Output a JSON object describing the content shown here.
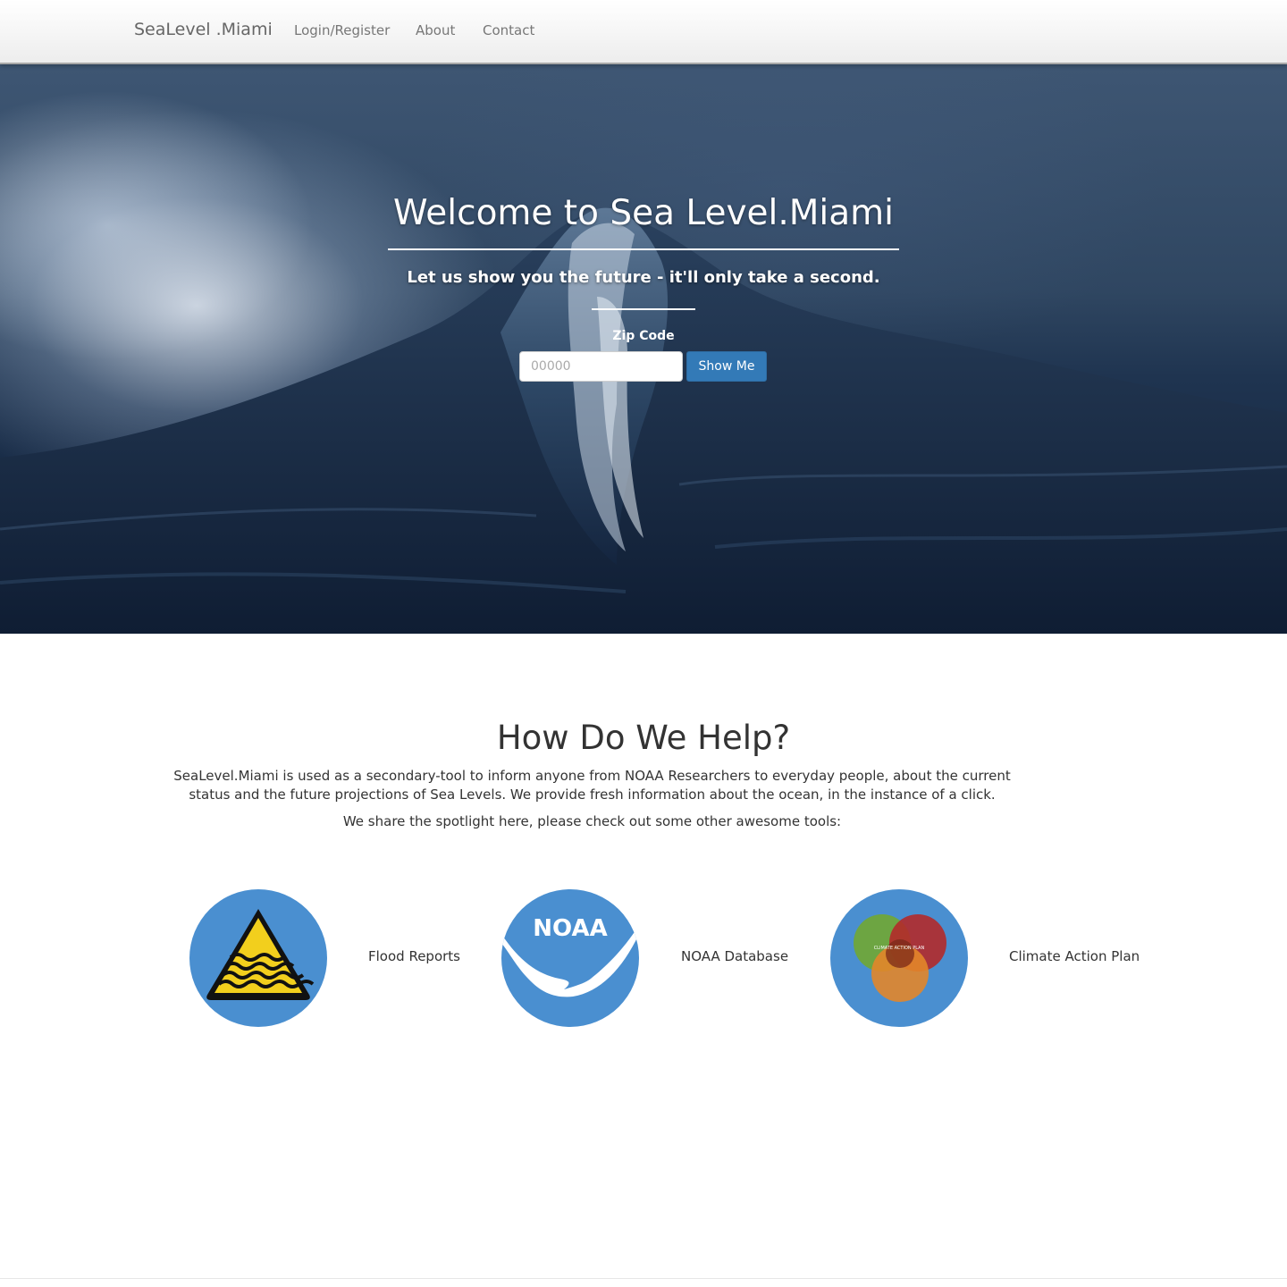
{
  "navbar": {
    "brand": "SeaLevel .Miami",
    "links": [
      "Login/Register",
      "About",
      "Contact"
    ]
  },
  "hero": {
    "title": "Welcome to Sea Level.Miami",
    "subtitle": "Let us show you the future - it'll only take a second.",
    "zip_label": "Zip Code",
    "zip_placeholder": "00000",
    "zip_value": "",
    "button_label": "Show Me"
  },
  "help": {
    "title": "How Do We Help?",
    "paragraph": "SeaLevel.Miami is used as a secondary-tool to inform anyone from NOAA Researchers to everyday people, about the current status and the future projections of Sea Levels. We provide fresh information about the ocean, in the instance of a click.",
    "spotlight": "We share the spotlight here, please check out some other awesome tools:",
    "tools": [
      {
        "label": "Flood Reports",
        "icon": "flood-warning-icon"
      },
      {
        "label": "NOAA Database",
        "icon": "noaa-logo",
        "logo_text": "NOAA"
      },
      {
        "label": "Climate Action Plan",
        "icon": "climate-action-plan-logo",
        "logo_text": "CLIMATE ACTION PLAN"
      }
    ]
  },
  "colors": {
    "primary_button": "#337ab7",
    "tool_circle": "#4a8fd0",
    "hero_dark": "#172a45"
  }
}
